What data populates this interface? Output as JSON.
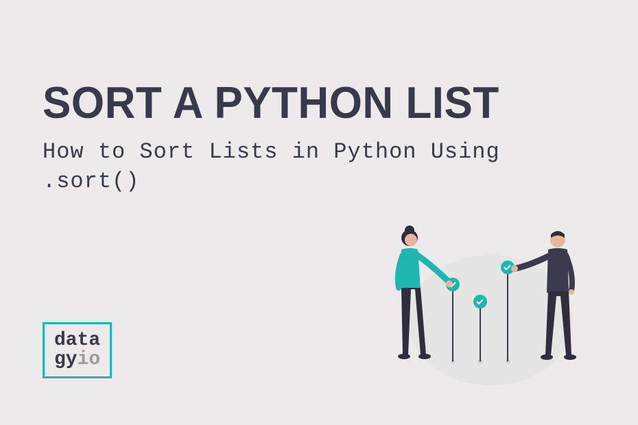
{
  "title": "SORT A PYTHON LIST",
  "subtitle": "How to Sort Lists in Python Using .sort()",
  "logo": {
    "line1": "data",
    "line2a": "gy",
    "line2b": "io"
  },
  "colors": {
    "bg": "#eceaea",
    "text": "#38394a",
    "accent": "#1fb5b0",
    "muted": "#9b9b9b"
  }
}
